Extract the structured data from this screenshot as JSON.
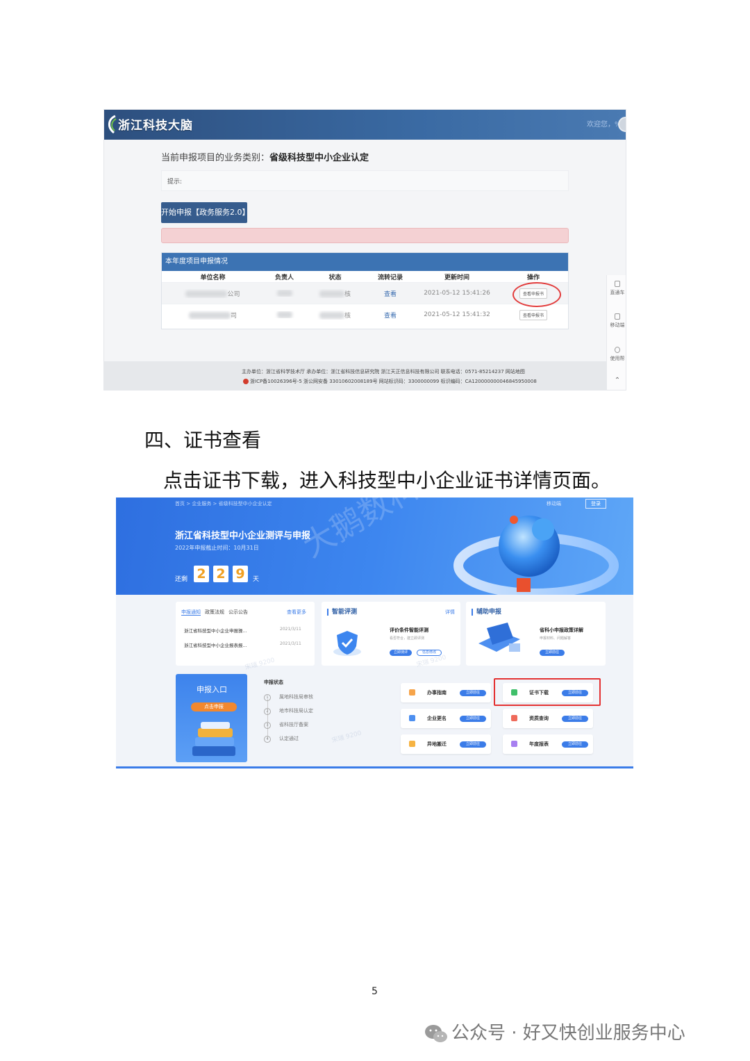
{
  "screenshot1": {
    "logo": "浙江科技大脑",
    "welcome": "欢迎您，%",
    "category_label": "当前申报项目的业务类别：",
    "category_value": "省级科技型中小企业认定",
    "tip": "提示:",
    "start_button": "开始申报【政务服务2.0】",
    "table_title": "本年度项目申报情况",
    "columns": [
      "单位名称",
      "负责人",
      "状态",
      "流转记录",
      "更新时间",
      "操作"
    ],
    "rows": [
      {
        "company_suffix": "公司",
        "status_suffix": "核",
        "record": "查看",
        "time": "2021-05-12 15:41:26",
        "action": "查看申报书"
      },
      {
        "company_suffix": "司",
        "status_suffix": "核",
        "record": "查看",
        "time": "2021-05-12 15:41:32",
        "action": "查看申报书"
      }
    ],
    "footer_line1": "主办单位：浙江省科学技术厅 承办单位：浙江省科技信息研究院 浙江天正信息科技有限公司 联系电话：0571-85214237 网站地图",
    "footer_line2": "浙ICP备10026396号-5 浙公网安备 33010602008189号 网站标识码：3300000099 标识编码：CA120000000046845950008",
    "side_items": [
      "直通车",
      "移动端",
      "使用帮"
    ]
  },
  "heading": "四、证书查看",
  "paragraph": "点击证书下载，进入科技型中小企业证书详情页面。",
  "screenshot2": {
    "breadcrumb": "首页 > 企业服务 > 省级科技型中小企业认定",
    "mobile": "移动端",
    "login": "登录",
    "title": "浙江省科技型中小企业测评与申报",
    "deadline": "2022年申报截止时间：10月31日",
    "remain_label": "还剩",
    "digits": [
      "2",
      "2",
      "9"
    ],
    "day_label": "天",
    "watermark": "大鹅数科",
    "corner_watermark": "宋瑞 9200",
    "news_tabs": [
      "申报通知",
      "政策法规",
      "公示公告"
    ],
    "news_more": "查看更多",
    "news": [
      {
        "title": "浙江省科技型中小企业申报操...",
        "date": "2021/3/11"
      },
      {
        "title": "浙江省科技型中小企业报表报...",
        "date": "2021/3/11"
      }
    ],
    "smart_title": "智能评测",
    "smart_detail": "详情",
    "smart_item": "评价条件智能评测",
    "smart_desc": "看否符合，建立即评测",
    "smart_btn1": "立即测评",
    "smart_btn2": "信息修改",
    "assist_title": "辅助申报",
    "assist_item": "省科小申报政策详解",
    "assist_desc": "申报材料、问题解答",
    "assist_btn": "立即前往",
    "entry_title": "申报入口",
    "entry_button": "点击申报",
    "status_title": "申报状态",
    "steps": [
      "属地科技局审核",
      "地市科技局认定",
      "省科技厅备案",
      "认定通过"
    ],
    "services": [
      {
        "label": "办事指南",
        "btn": "立即前往"
      },
      {
        "label": "证书下载",
        "btn": "立即前往"
      },
      {
        "label": "企业更名",
        "btn": "立即前往"
      },
      {
        "label": "资质查询",
        "btn": "立即前往"
      },
      {
        "label": "异地搬迁",
        "btn": "立即前往"
      },
      {
        "label": "年度报表",
        "btn": "立即前往"
      }
    ]
  },
  "page_number": "5",
  "wechat_footer": "公众号 · 好又快创业服务中心"
}
